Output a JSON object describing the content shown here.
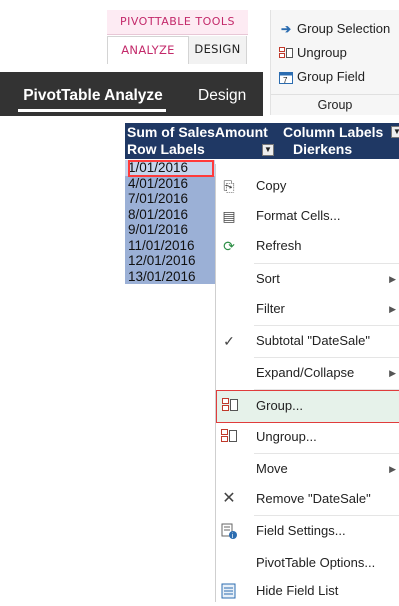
{
  "ribbon": {
    "tools_header": "PIVOTTABLE TOOLS",
    "tab_analyze": "ANALYZE",
    "tab_design": "DESIGN",
    "group_selection": "Group Selection",
    "ungroup": "Ungroup",
    "group_field": "Group Field",
    "group_label": "Group"
  },
  "dark_tabs": {
    "analyze": "PivotTable Analyze",
    "design": "Design"
  },
  "pivot": {
    "sum_of": "Sum of SalesAmount",
    "column_labels": "Column Labels",
    "row_labels": "Row Labels",
    "column_value": "Dierkens",
    "rows": [
      "1/01/2016",
      "4/01/2016",
      "7/01/2016",
      "8/01/2016",
      "9/01/2016",
      "11/01/2016",
      "12/01/2016",
      "13/01/2016"
    ]
  },
  "menu": {
    "copy": "Copy",
    "format_cells": "Format Cells...",
    "refresh": "Refresh",
    "sort": "Sort",
    "filter": "Filter",
    "subtotal": "Subtotal \"DateSale\"",
    "expand_collapse": "Expand/Collapse",
    "group": "Group...",
    "ungroup": "Ungroup...",
    "move": "Move",
    "remove": "Remove \"DateSale\"",
    "field_settings": "Field Settings...",
    "pivot_options": "PivotTable Options...",
    "hide_field_list": "Hide Field List"
  },
  "colors": {
    "accent_pink": "#c3296a",
    "pivot_header": "#1f3864",
    "pivot_row": "#9bb0d6",
    "dark_bar": "#333333"
  }
}
